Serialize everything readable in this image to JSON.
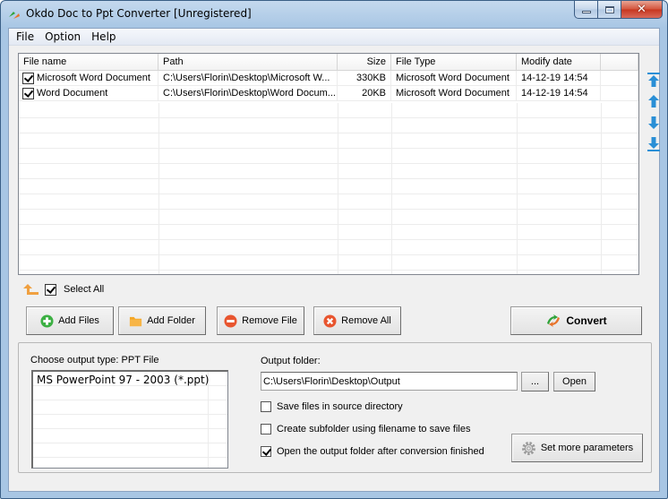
{
  "window": {
    "title": "Okdo Doc to Ppt Converter [Unregistered]",
    "buttons": {
      "minimize": "minimize",
      "maximize": "maximize",
      "close": "✕"
    }
  },
  "menu": [
    {
      "label": "File"
    },
    {
      "label": "Option"
    },
    {
      "label": "Help"
    }
  ],
  "file_list": {
    "columns": [
      "File name",
      "Path",
      "Size",
      "File Type",
      "Modify date"
    ],
    "rows": [
      {
        "checked": true,
        "name": "Microsoft Word Document",
        "path": "C:\\Users\\Florin\\Desktop\\Microsoft W...",
        "size": "330KB",
        "type": "Microsoft Word Document",
        "date": "14-12-19 14:54"
      },
      {
        "checked": true,
        "name": "Word Document",
        "path": "C:\\Users\\Florin\\Desktop\\Word Docum...",
        "size": "20KB",
        "type": "Microsoft Word Document",
        "date": "14-12-19 14:54"
      }
    ]
  },
  "side_arrows": [
    "move-to-top",
    "move-up",
    "move-down",
    "move-to-bottom"
  ],
  "select_all": {
    "label": "Select All",
    "checked": true
  },
  "buttons": {
    "add_files": "Add Files",
    "add_folder": "Add Folder",
    "remove_file": "Remove File",
    "remove_all": "Remove All",
    "convert": "Convert",
    "browse": "...",
    "open": "Open",
    "more_params": "Set more parameters"
  },
  "output": {
    "type_label": "Choose output type:  PPT File",
    "types": [
      "MS PowerPoint 97 - 2003 (*.ppt)"
    ],
    "folder_label": "Output folder:",
    "folder_value": "C:\\Users\\Florin\\Desktop\\Output",
    "options": [
      {
        "label": "Save files in source directory",
        "checked": false
      },
      {
        "label": "Create subfolder using filename to save files",
        "checked": false
      },
      {
        "label": "Open the output folder after conversion finished",
        "checked": true
      }
    ]
  },
  "colors": {
    "titlebar": "#a8c6e4",
    "client_bg": "#f0f0f0",
    "arrow_blue": "#2a8fd6",
    "add_green": "#3cb043",
    "folder_orange": "#f5a623",
    "remove_red": "#e8552f"
  }
}
